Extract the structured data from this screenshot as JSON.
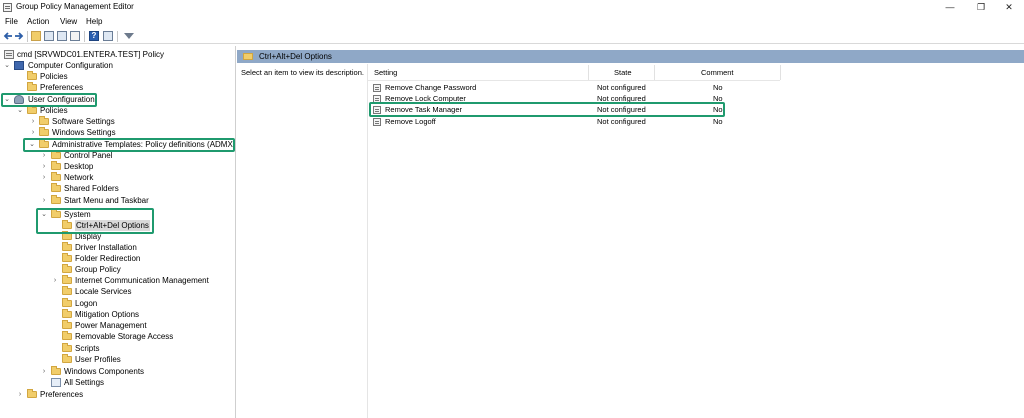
{
  "window": {
    "title": "Group Policy Management Editor",
    "minimize": "—",
    "maximize": "❐",
    "close": "✕"
  },
  "menu": [
    "File",
    "Action",
    "View",
    "Help"
  ],
  "tree": {
    "root": "cmd [SRVWDC01.ENTERA.TEST] Policy",
    "computer_configuration": "Computer Configuration",
    "cc_policies": "Policies",
    "cc_preferences": "Preferences",
    "user_configuration": "User Configuration",
    "uc_policies": "Policies",
    "software_settings": "Software Settings",
    "windows_settings": "Windows Settings",
    "admin_templates": "Administrative Templates: Policy definitions (ADMX fil",
    "control_panel": "Control Panel",
    "desktop": "Desktop",
    "network": "Network",
    "shared_folders": "Shared Folders",
    "start_menu": "Start Menu and Taskbar",
    "system": "System",
    "system_children": [
      "Ctrl+Alt+Del Options",
      "Display",
      "Driver Installation",
      "Folder Redirection",
      "Group Policy",
      "Internet Communication Management",
      "Locale Services",
      "Logon",
      "Mitigation Options",
      "Power Management",
      "Removable Storage Access",
      "Scripts",
      "User Profiles"
    ],
    "windows_components": "Windows Components",
    "all_settings": "All Settings",
    "uc_preferences": "Preferences"
  },
  "right": {
    "header_title": "Ctrl+Alt+Del Options",
    "description": "Select an item to view its description.",
    "columns": {
      "setting": "Setting",
      "state": "State",
      "comment": "Comment"
    },
    "rows": [
      {
        "setting": "Remove Change Password",
        "state": "Not configured",
        "comment": "No"
      },
      {
        "setting": "Remove Lock Computer",
        "state": "Not configured",
        "comment": "No"
      },
      {
        "setting": "Remove Task Manager",
        "state": "Not configured",
        "comment": "No"
      },
      {
        "setting": "Remove Logoff",
        "state": "Not configured",
        "comment": "No"
      }
    ]
  },
  "colors": {
    "accent_highlight": "#1f9a6e",
    "header_bar": "#8fa8c7"
  }
}
